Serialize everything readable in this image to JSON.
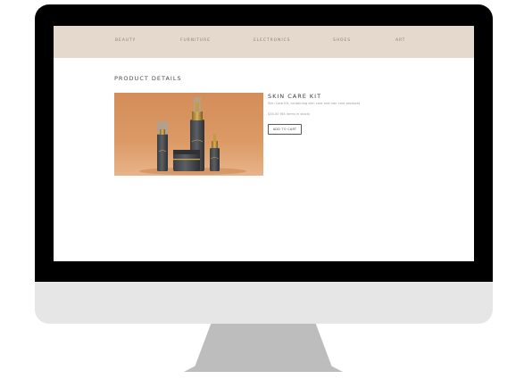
{
  "nav": {
    "items": [
      {
        "label": "BEAUTY"
      },
      {
        "label": "FURNITURE"
      },
      {
        "label": "ELECTRONICS"
      },
      {
        "label": "SHOES"
      },
      {
        "label": "ART"
      }
    ]
  },
  "page": {
    "title": "PRODUCT DETAILS"
  },
  "product": {
    "name": "SKIN CARE KIT",
    "description": "Skin Care Kit, containing skin care and hair care products",
    "price_line": "$30.00 (65 items in stock)",
    "add_to_cart_label": "ADD TO CART"
  },
  "colors": {
    "navbar_background": "#e5d9cd",
    "image_background": "#d9935f",
    "bezel": "#000000",
    "chin": "#e6e6e6",
    "stand": "#bdbdbd"
  }
}
